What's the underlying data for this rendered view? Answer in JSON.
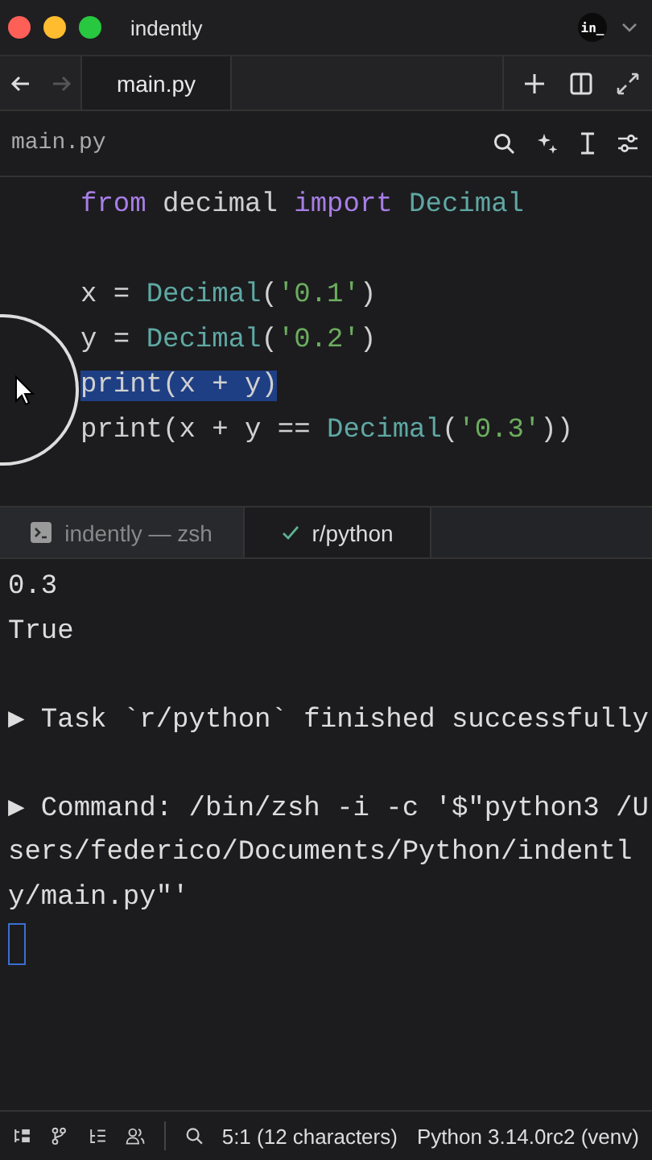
{
  "window": {
    "title": "indently",
    "account_badge": "in_"
  },
  "tabs": [
    {
      "label": "main.py",
      "selected": true
    }
  ],
  "editor": {
    "file_name": "main.py",
    "lines": [
      {
        "selected": false,
        "tokens": [
          {
            "kind": "kw",
            "text": "from"
          },
          {
            "kind": "plain",
            "text": " decimal "
          },
          {
            "kind": "kw",
            "text": "import"
          },
          {
            "kind": "cls",
            "text": " Decimal"
          }
        ]
      },
      {
        "selected": false
      },
      {
        "selected": false,
        "tokens": [
          {
            "kind": "plain",
            "text": "x = "
          },
          {
            "kind": "cls",
            "text": "Decimal"
          },
          {
            "kind": "plain",
            "text": "("
          },
          {
            "kind": "str",
            "text": "'0.1'"
          },
          {
            "kind": "plain",
            "text": ")"
          }
        ]
      },
      {
        "selected": false,
        "tokens": [
          {
            "kind": "plain",
            "text": "y = "
          },
          {
            "kind": "cls",
            "text": "Decimal"
          },
          {
            "kind": "plain",
            "text": "("
          },
          {
            "kind": "str",
            "text": "'0.2'"
          },
          {
            "kind": "plain",
            "text": ")"
          }
        ]
      },
      {
        "selected": true,
        "tokens": [
          {
            "kind": "plain",
            "text": "print(x + y)"
          }
        ]
      },
      {
        "selected": false,
        "tokens": [
          {
            "kind": "plain",
            "text": "print(x + y == "
          },
          {
            "kind": "cls",
            "text": "Decimal"
          },
          {
            "kind": "plain",
            "text": "("
          },
          {
            "kind": "str",
            "text": "'0.3'"
          },
          {
            "kind": "plain",
            "text": "))"
          }
        ]
      }
    ]
  },
  "terminal": {
    "tabs": [
      {
        "kind": "shell",
        "label": "indently — zsh",
        "selected": false
      },
      {
        "kind": "task",
        "label": "r/python",
        "selected": true
      }
    ],
    "output": [
      {
        "kind": "text",
        "text": "0.3"
      },
      {
        "kind": "text",
        "text": "True"
      },
      {
        "kind": "blank"
      },
      {
        "kind": "task",
        "text": "▶ Task `r/python` finished successfully"
      },
      {
        "kind": "blank"
      },
      {
        "kind": "task",
        "text": "▶ Command: /bin/zsh -i -c '$\"python3 /Users/federico/Documents/Python/indently/main.py\"'"
      }
    ]
  },
  "status_bar": {
    "position": "5:1 (12 characters)",
    "interpreter": "Python 3.14.0rc2 (venv)"
  }
}
